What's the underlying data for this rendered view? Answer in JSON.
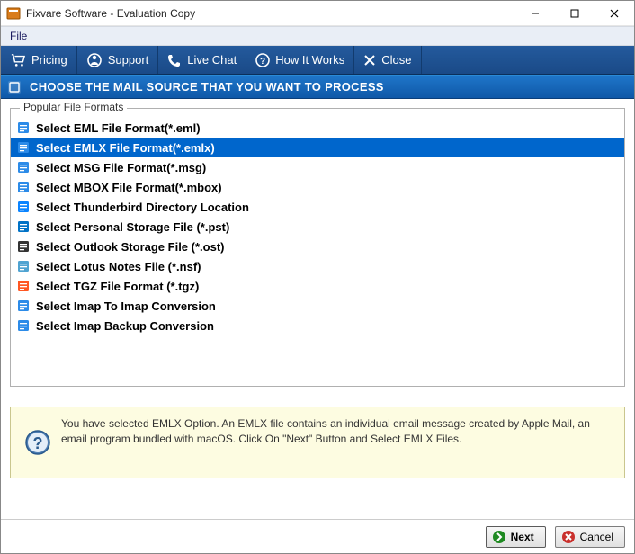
{
  "window_title": "Fixvare Software - Evaluation Copy",
  "menubar": {
    "items": [
      "File"
    ]
  },
  "toolbar": {
    "buttons": [
      {
        "icon": "cart-icon",
        "label": "Pricing"
      },
      {
        "icon": "support-icon",
        "label": "Support"
      },
      {
        "icon": "phone-icon",
        "label": "Live Chat"
      },
      {
        "icon": "question-icon",
        "label": "How It Works"
      },
      {
        "icon": "close-x-icon",
        "label": "Close"
      }
    ]
  },
  "section_header": "CHOOSE THE MAIL SOURCE THAT YOU WANT TO PROCESS",
  "groupbox_label": "Popular File Formats",
  "formats": [
    {
      "label": "Select EML File Format(*.eml)",
      "selected": false,
      "icon_color": "#2c8be8"
    },
    {
      "label": "Select EMLX File Format(*.emlx)",
      "selected": true,
      "icon_color": "#2c8be8"
    },
    {
      "label": "Select MSG File Format(*.msg)",
      "selected": false,
      "icon_color": "#2c8be8"
    },
    {
      "label": "Select MBOX File Format(*.mbox)",
      "selected": false,
      "icon_color": "#2c8be8"
    },
    {
      "label": "Select Thunderbird Directory Location",
      "selected": false,
      "icon_color": "#0a84ff"
    },
    {
      "label": "Select Personal Storage File (*.pst)",
      "selected": false,
      "icon_color": "#0072c6"
    },
    {
      "label": "Select Outlook Storage File (*.ost)",
      "selected": false,
      "icon_color": "#333333"
    },
    {
      "label": "Select Lotus Notes File (*.nsf)",
      "selected": false,
      "icon_color": "#4fa3d1"
    },
    {
      "label": "Select TGZ File Format (*.tgz)",
      "selected": false,
      "icon_color": "#ff5722"
    },
    {
      "label": "Select Imap To Imap Conversion",
      "selected": false,
      "icon_color": "#2c8be8"
    },
    {
      "label": "Select Imap Backup Conversion",
      "selected": false,
      "icon_color": "#2c8be8"
    }
  ],
  "info_text": "You have selected EMLX Option. An EMLX file contains an individual email message created by Apple Mail, an email program bundled with macOS. Click On \"Next\" Button and Select EMLX Files.",
  "footer": {
    "next_label": "Next",
    "cancel_label": "Cancel"
  }
}
